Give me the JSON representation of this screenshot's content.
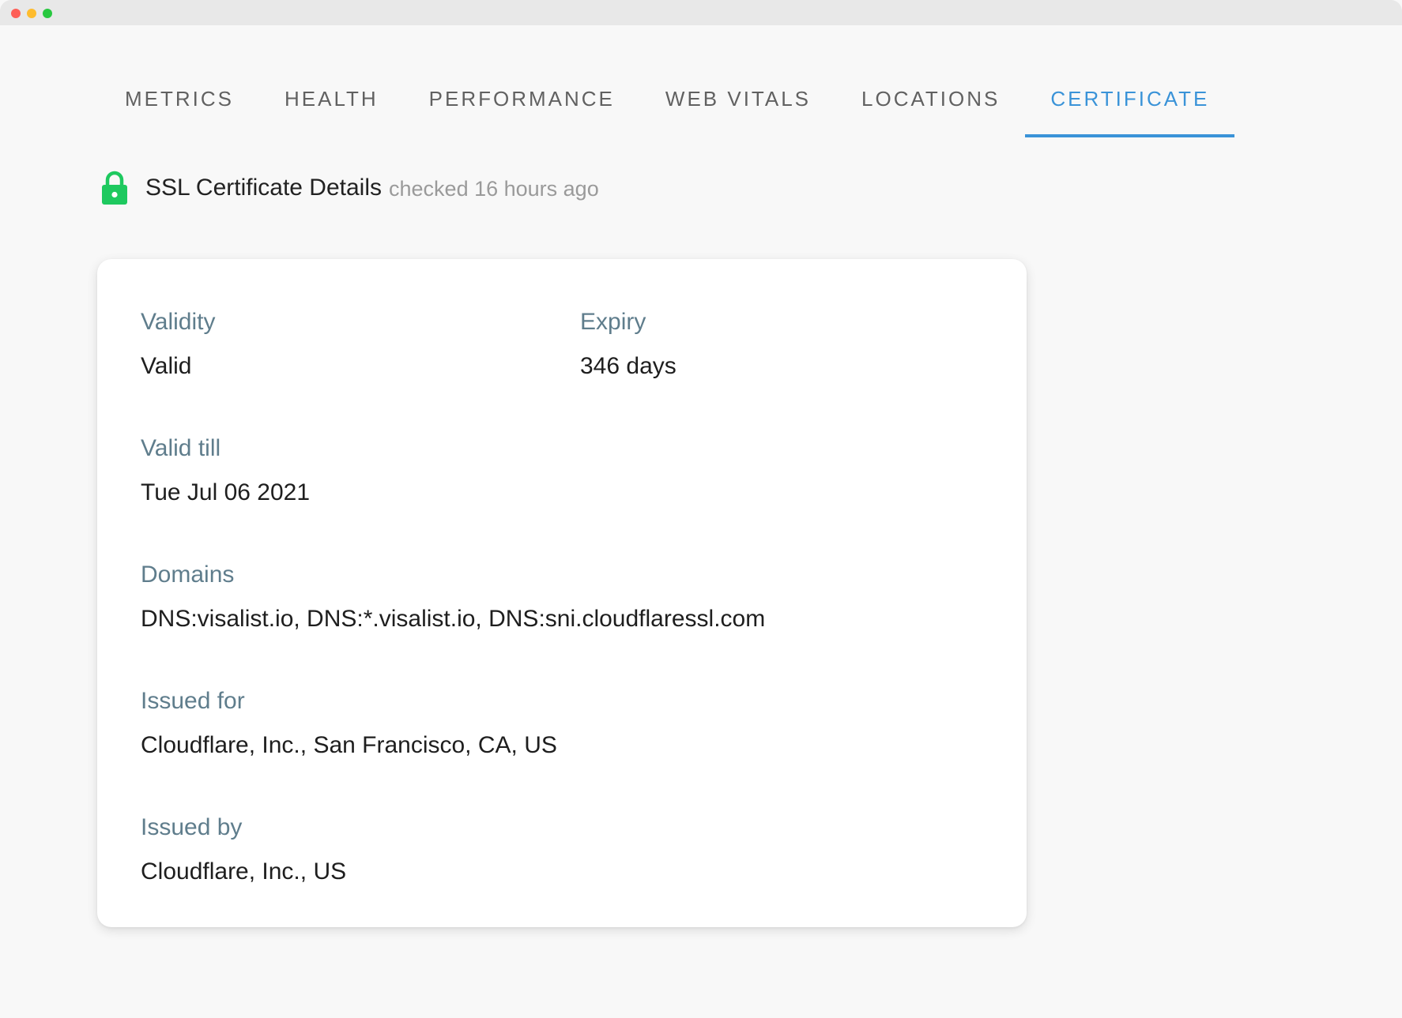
{
  "tabs": [
    {
      "label": "METRICS",
      "active": false
    },
    {
      "label": "HEALTH",
      "active": false
    },
    {
      "label": "PERFORMANCE",
      "active": false
    },
    {
      "label": "WEB VITALS",
      "active": false
    },
    {
      "label": "LOCATIONS",
      "active": false
    },
    {
      "label": "CERTIFICATE",
      "active": true
    }
  ],
  "heading": {
    "icon": "lock-icon",
    "title": "SSL Certificate Details",
    "subtitle": "checked 16 hours ago"
  },
  "certificate": {
    "validity": {
      "label": "Validity",
      "value": "Valid"
    },
    "expiry": {
      "label": "Expiry",
      "value": "346 days"
    },
    "valid_till": {
      "label": "Valid till",
      "value": "Tue Jul 06 2021"
    },
    "domains": {
      "label": "Domains",
      "value": "DNS:visalist.io, DNS:*.visalist.io, DNS:sni.cloudflaressl.com"
    },
    "issued_for": {
      "label": "Issued for",
      "value": "Cloudflare, Inc., San Francisco, CA, US"
    },
    "issued_by": {
      "label": "Issued by",
      "value": "Cloudflare, Inc., US"
    }
  },
  "colors": {
    "accent": "#3a93d8",
    "lock": "#1ec95f",
    "label": "#5f7d8c"
  }
}
